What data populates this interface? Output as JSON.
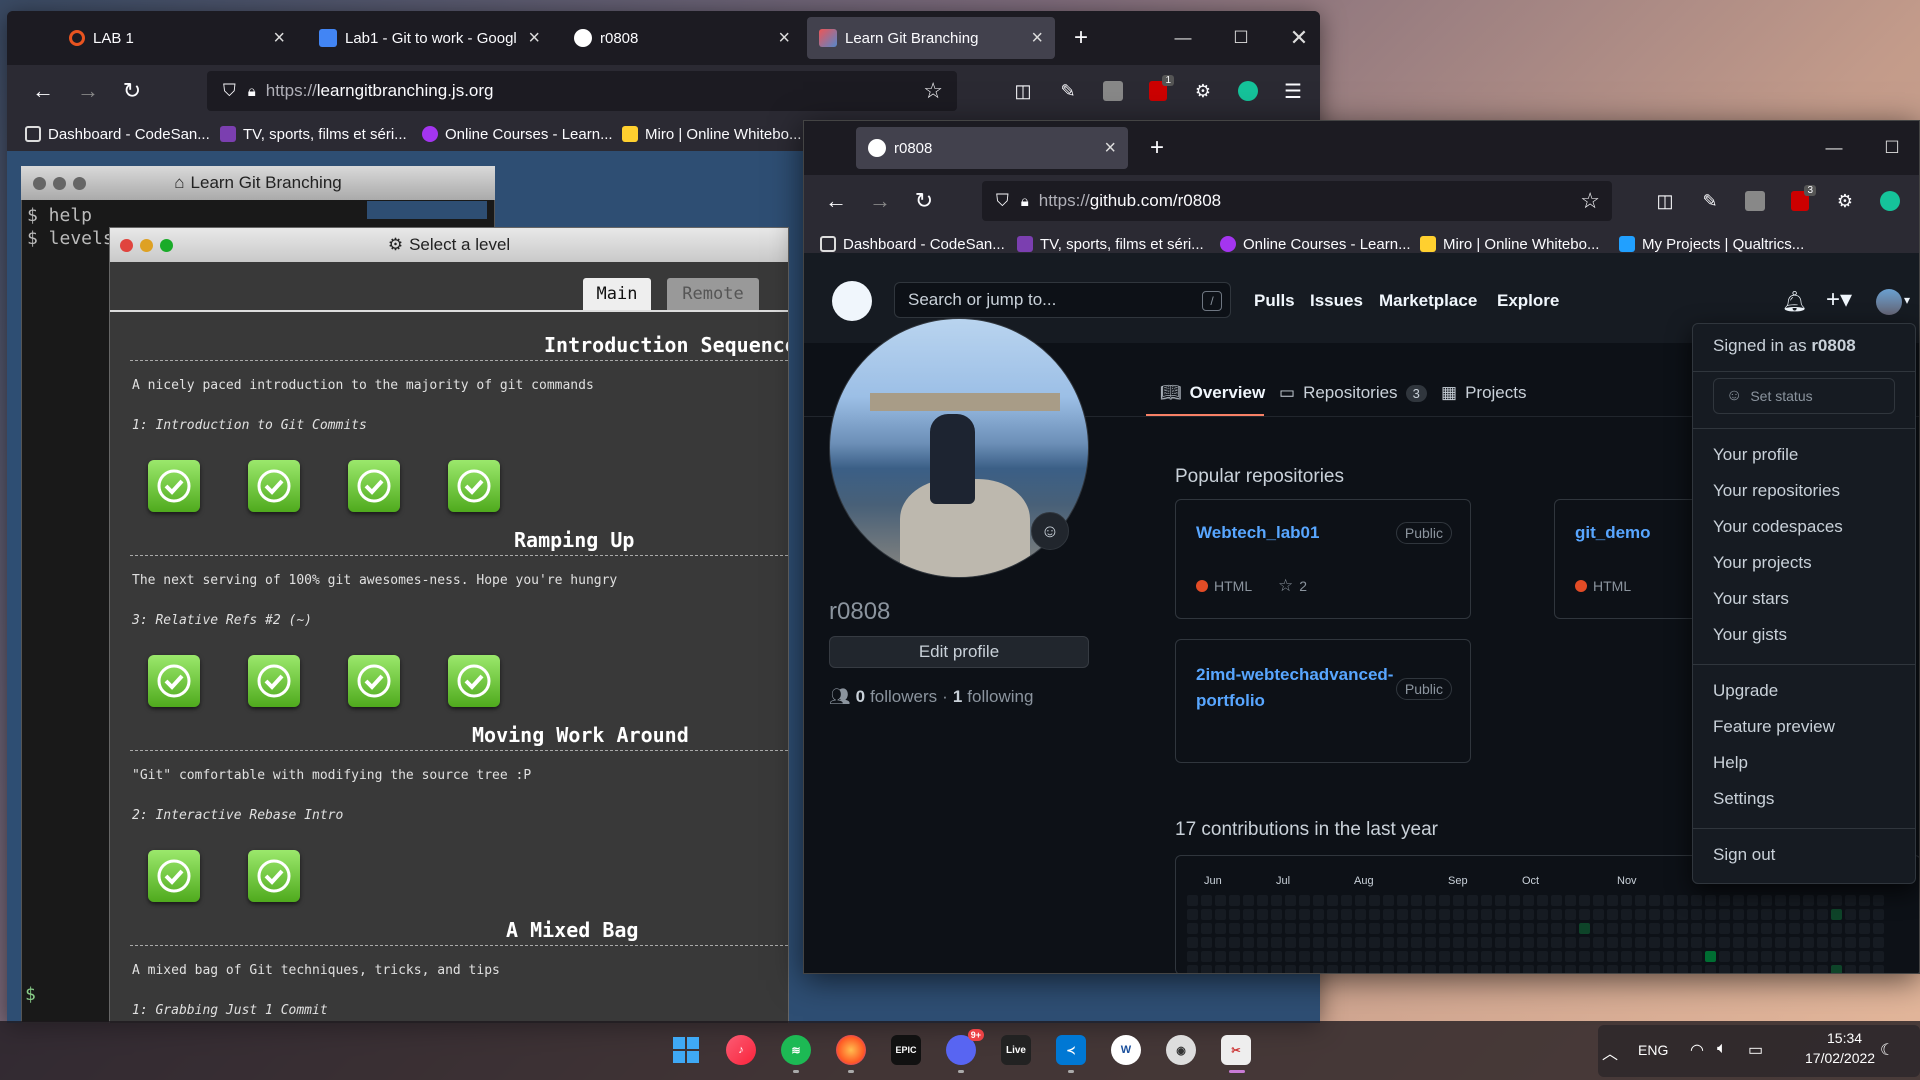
{
  "win1": {
    "tabs": [
      {
        "label": "LAB 1",
        "fav": "ubuntu-icon"
      },
      {
        "label": "Lab1 - Git to work - Googl",
        "fav": "google-docs-icon"
      },
      {
        "label": "r0808",
        "fav": "github-icon"
      },
      {
        "label": "Learn Git Branching",
        "fav": "lgb-icon"
      }
    ],
    "url_proto": "https://",
    "url_host": "learngitbranching.js.org",
    "ext_badge": "1",
    "bookmarks": [
      "Dashboard - CodeSan...",
      "TV, sports, films et séri...",
      "Online Courses - Learn...",
      "Miro | Online Whitebo..."
    ]
  },
  "lgb": {
    "term_title": "Learn Git Branching",
    "term_lines": [
      "$ help",
      "$ levels"
    ],
    "prompt": "$",
    "modal_title": "Select a level",
    "tabs": {
      "main": "Main",
      "remote": "Remote"
    },
    "sections": [
      {
        "title": "Introduction Sequence",
        "desc": "A nicely paced introduction to the majority of git commands",
        "level": "1: Introduction to Git Commits",
        "done": 4
      },
      {
        "title": "Ramping Up",
        "desc": "The next serving of 100% git awesomes-ness. Hope you're hungry",
        "level": "3: Relative Refs #2 (~)",
        "done": 4
      },
      {
        "title": "Moving Work Around",
        "desc": "\"Git\" comfortable with modifying the source tree :P",
        "level": "2: Interactive Rebase Intro",
        "done": 2
      },
      {
        "title": "A Mixed Bag",
        "desc": "A mixed bag of Git techniques, tricks, and tips",
        "level": "1: Grabbing Just 1 Commit",
        "done": 0
      }
    ]
  },
  "win2": {
    "tab": "r0808",
    "url_proto": "https://",
    "url_host": "github.com/r0808",
    "ext_badge": "3",
    "bookmarks": [
      "Dashboard - CodeSan...",
      "TV, sports, films et séri...",
      "Online Courses - Learn...",
      "Miro | Online Whitebo...",
      "My Projects | Qualtrics..."
    ]
  },
  "github": {
    "search_placeholder": "Search or jump to...",
    "slash": "/",
    "nav": [
      "Pulls",
      "Issues",
      "Marketplace",
      "Explore"
    ],
    "tabs": {
      "overview": "Overview",
      "repositories": "Repositories",
      "repo_count": "3",
      "projects": "Projects"
    },
    "username": "r0808",
    "edit_profile": "Edit profile",
    "followers": "0",
    "followers_label": "followers",
    "sep": "·",
    "following": "1",
    "following_label": "following",
    "popular_title": "Popular repositories",
    "repos": [
      {
        "name": "Webtech_lab01",
        "badge": "Public",
        "lang": "HTML",
        "stars": "2"
      },
      {
        "name": "git_demo",
        "badge": "",
        "lang": "HTML",
        "stars": ""
      },
      {
        "name": "2imd-webtechadvanced-portfolio",
        "badge": "Public",
        "lang": "",
        "stars": ""
      }
    ],
    "contrib_title": "17 contributions in the last year",
    "months": [
      "Jun",
      "Jul",
      "Aug",
      "Sep",
      "Oct",
      "Nov"
    ],
    "dropdown": {
      "signed_in_prefix": "Signed in as",
      "signed_in_user": "r0808",
      "set_status": "Set status",
      "group1": [
        "Your profile",
        "Your repositories",
        "Your codespaces",
        "Your projects",
        "Your stars",
        "Your gists"
      ],
      "group2": [
        "Upgrade",
        "Feature preview",
        "Help",
        "Settings"
      ],
      "sign_out": "Sign out"
    }
  },
  "taskbar": {
    "discord_badge": "9+",
    "live": "Live",
    "epic": "EPIC",
    "lang": "ENG",
    "time": "15:34",
    "date": "17/02/2022"
  }
}
